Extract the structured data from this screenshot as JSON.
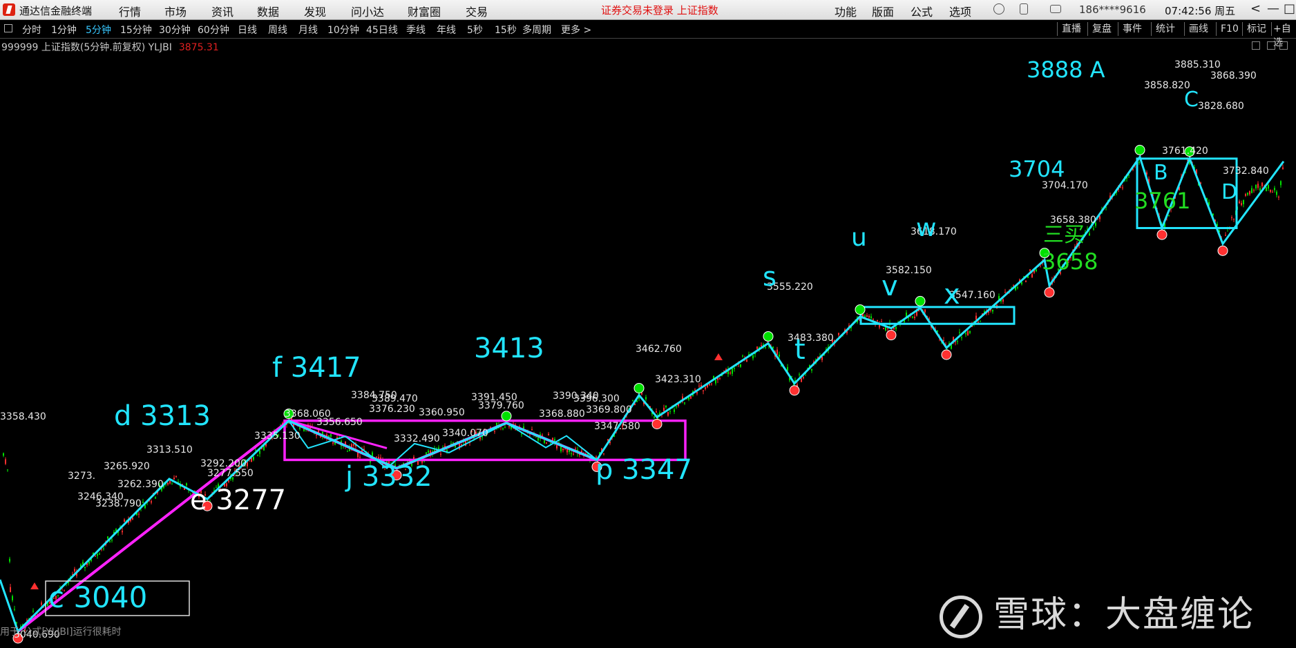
{
  "app": {
    "title": "通达信金融终端",
    "menus": [
      "行情",
      "市场",
      "资讯",
      "数据",
      "发现",
      "问小达",
      "财富圈",
      "交易"
    ],
    "warning": "证券交易未登录  上证指数",
    "tools": [
      "功能",
      "版面",
      "公式",
      "选项"
    ],
    "phone": "186****9616",
    "clock": "07:42:56 周五",
    "ctrl_prev": "<",
    "ctrl_min": "—",
    "ctrl_max": "□",
    "ctrl_close": "✕"
  },
  "period_bar": {
    "items": [
      "分时",
      "1分钟",
      "5分钟",
      "15分钟",
      "30分钟",
      "60分钟",
      "日线",
      "周线",
      "月线",
      "10分钟",
      "45日线",
      "季线",
      "年线",
      "5秒",
      "15秒",
      "多周期",
      "更多 >"
    ],
    "active_index": 2,
    "right_tools": [
      "直播",
      "复盘",
      "事件",
      "统计",
      "画线",
      "F10",
      "标记",
      "+自选"
    ]
  },
  "info_line": {
    "label": "999999 上证指数(5分钟.前复权) YLJBI",
    "value": "3875.31"
  },
  "footer_note": "用于 公式[YLJBI]运行很耗时",
  "watermark": "雪球：大盘缠论",
  "colors": {
    "up": "#ff3030",
    "down": "#00e000",
    "wave": "#22e5ff",
    "pivot": "#ff22ff",
    "label_cyan": "#22e5ff",
    "label_white": "#ffffff",
    "label_green": "#22dd22"
  },
  "chart_data": {
    "type": "line",
    "title": "",
    "xlabel": "",
    "ylabel": "",
    "ylim": [
      3000,
      3900
    ],
    "grid": false,
    "wave_points": [
      {
        "label": "c",
        "value": 3040.69
      },
      {
        "label": "d",
        "value": 3313
      },
      {
        "label": "e",
        "value": 3277
      },
      {
        "label": "f",
        "value": 3417
      },
      {
        "label": "j",
        "value": 3332
      },
      {
        "label": "",
        "value": 3413
      },
      {
        "label": "p",
        "value": 3347
      },
      {
        "label": "",
        "value": 3462.76
      },
      {
        "label": "",
        "value": 3423.31
      },
      {
        "label": "s",
        "value": 3555.22
      },
      {
        "label": "t",
        "value": 3483.38
      },
      {
        "label": "u",
        "value": 3603
      },
      {
        "label": "v",
        "value": 3582.15
      },
      {
        "label": "w",
        "value": 3618.17
      },
      {
        "label": "x",
        "value": 3547.16
      },
      {
        "label": "",
        "value": 3704.17
      },
      {
        "label": "",
        "value": 3658.38
      },
      {
        "label": "A",
        "value": 3888
      },
      {
        "label": "B",
        "value": 3761.42
      },
      {
        "label": "C",
        "value": 3885.31
      },
      {
        "label": "D",
        "value": 3732.84
      }
    ],
    "big_labels": [
      {
        "text": "c 3040",
        "color": "label_cyan",
        "boxed": true
      },
      {
        "text": "d 3313",
        "color": "label_cyan"
      },
      {
        "text": "e 3277",
        "color": "label_white"
      },
      {
        "text": "f 3417",
        "color": "label_cyan"
      },
      {
        "text": "j  3332",
        "color": "label_cyan"
      },
      {
        "text": "3413",
        "color": "label_cyan"
      },
      {
        "text": "p  3347",
        "color": "label_cyan"
      },
      {
        "text": "s",
        "color": "label_cyan"
      },
      {
        "text": "t",
        "color": "label_cyan"
      },
      {
        "text": "u",
        "color": "label_cyan"
      },
      {
        "text": "v",
        "color": "label_cyan"
      },
      {
        "text": "w",
        "color": "label_cyan"
      },
      {
        "text": "x",
        "color": "label_cyan"
      },
      {
        "text": "3704",
        "color": "label_cyan"
      },
      {
        "text": "三买",
        "color": "label_green"
      },
      {
        "text": "3658",
        "color": "label_green"
      },
      {
        "text": "3888 A",
        "color": "label_cyan"
      },
      {
        "text": "B",
        "color": "label_cyan"
      },
      {
        "text": "3761",
        "color": "label_green"
      },
      {
        "text": "C",
        "color": "label_cyan"
      },
      {
        "text": "D",
        "color": "label_cyan"
      }
    ],
    "price_annotations": [
      "3358.430",
      "3040.690",
      "3273.",
      "3246.340",
      "3238.790",
      "3262.390",
      "3265.920",
      "3313.510",
      "3292.200",
      "3277.550",
      "3335.130",
      "3368.060",
      "3356.650",
      "3332.490",
      "3376.230",
      "3384.750",
      "3389.470",
      "3340.070",
      "3360.950",
      "3391.450",
      "3379.760",
      "3368.880",
      "3390.340",
      "3396.300",
      "3369.800",
      "3347.580",
      "3462.760",
      "3423.310",
      "3555.220",
      "3483.380",
      "3582.150",
      "3618.170",
      "3547.160",
      "3704.170",
      "3658.380",
      "3885.310",
      "3858.820",
      "3868.390",
      "3828.680",
      "3761.420",
      "3732.840"
    ],
    "pivot_boxes": [
      {
        "name": "pivot-main",
        "low": 3347,
        "high": 3417
      },
      {
        "name": "pivot-uvwx",
        "low": 3590,
        "high": 3620
      },
      {
        "name": "pivot-ABCD",
        "low": 3761,
        "high": 3885
      }
    ]
  }
}
